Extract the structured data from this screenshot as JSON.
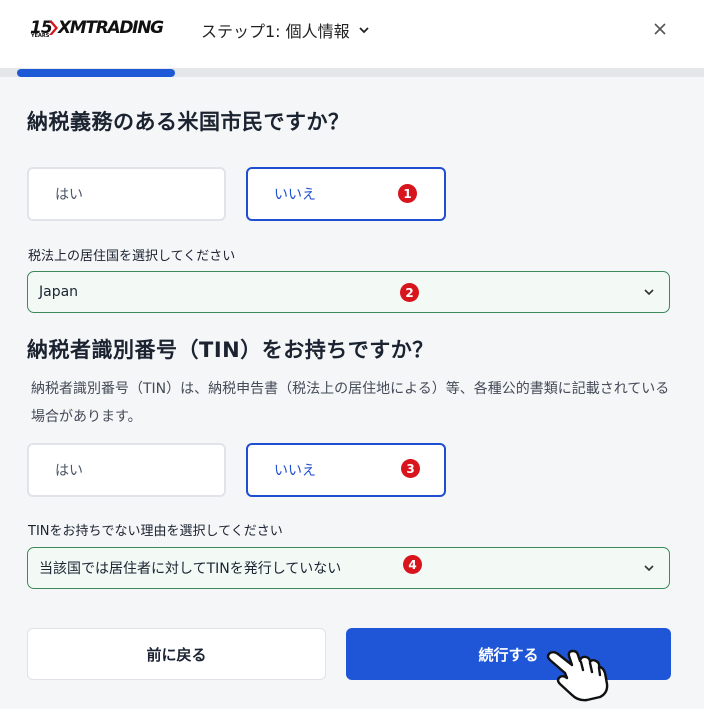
{
  "header": {
    "logo_years": "15",
    "logo_years_sub": "YEARS",
    "logo_brand": "XMTRADING",
    "step_title": "ステップ1: 個人情報",
    "progress": 0.22
  },
  "q_us_citizen": {
    "title": "納税義務のある米国市民ですか？",
    "yes_label": "はい",
    "no_label": "いいえ",
    "selected": "いいえ",
    "badge": "1"
  },
  "residence": {
    "label": "税法上の居住国を選択してください",
    "value": "Japan",
    "badge": "2"
  },
  "q_tin": {
    "title": "納税者識別番号（TIN）をお持ちですか？",
    "description": "納税者識別番号（TIN）は、納税申告書（税法上の居住地による）等、各種公的書類に記載されている場合があります。",
    "yes_label": "はい",
    "no_label": "いいえ",
    "selected": "いいえ",
    "badge": "3"
  },
  "no_tin_reason": {
    "label": "TINをお持ちでない理由を選択してください",
    "value": "当該国では居住者に対してTINを発行していない",
    "badge": "4"
  },
  "footer": {
    "back_label": "前に戻る",
    "next_label": "続行する"
  },
  "colors": {
    "accent": "#1f56d8",
    "badge": "#d8141d",
    "select_border": "#3e8a5a"
  }
}
